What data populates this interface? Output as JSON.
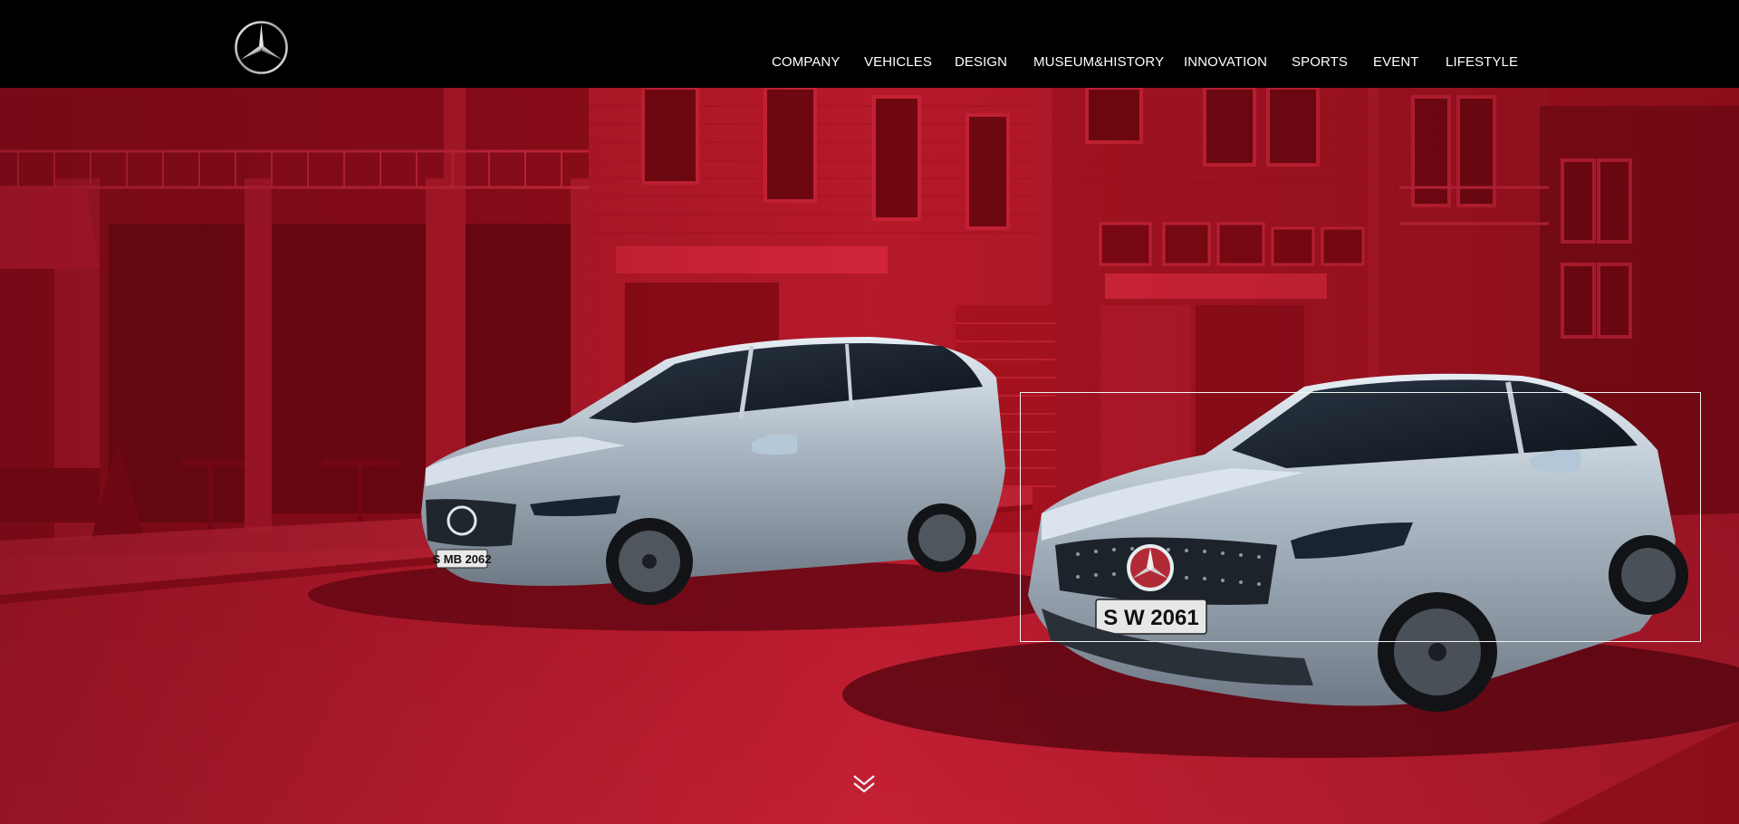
{
  "header": {
    "logo_icon": "mercedes-star-icon",
    "nav": [
      {
        "label": "COMPANY"
      },
      {
        "label": "VEHICLES"
      },
      {
        "label": "DESIGN"
      },
      {
        "label": "MUSEUM&HISTORY"
      },
      {
        "label": "INNOVATION"
      },
      {
        "label": "SPORTS"
      },
      {
        "label": "EVENT"
      },
      {
        "label": "LIFESTYLE"
      }
    ]
  },
  "hero": {
    "cars": [
      {
        "plate": "S MB 2062"
      },
      {
        "plate": "S W 2061"
      }
    ],
    "scroll_icon": "double-chevron-down-icon"
  },
  "colors": {
    "header_bg": "#000000",
    "scene_red": "#b3162a",
    "frame": "#f3f3f3"
  }
}
